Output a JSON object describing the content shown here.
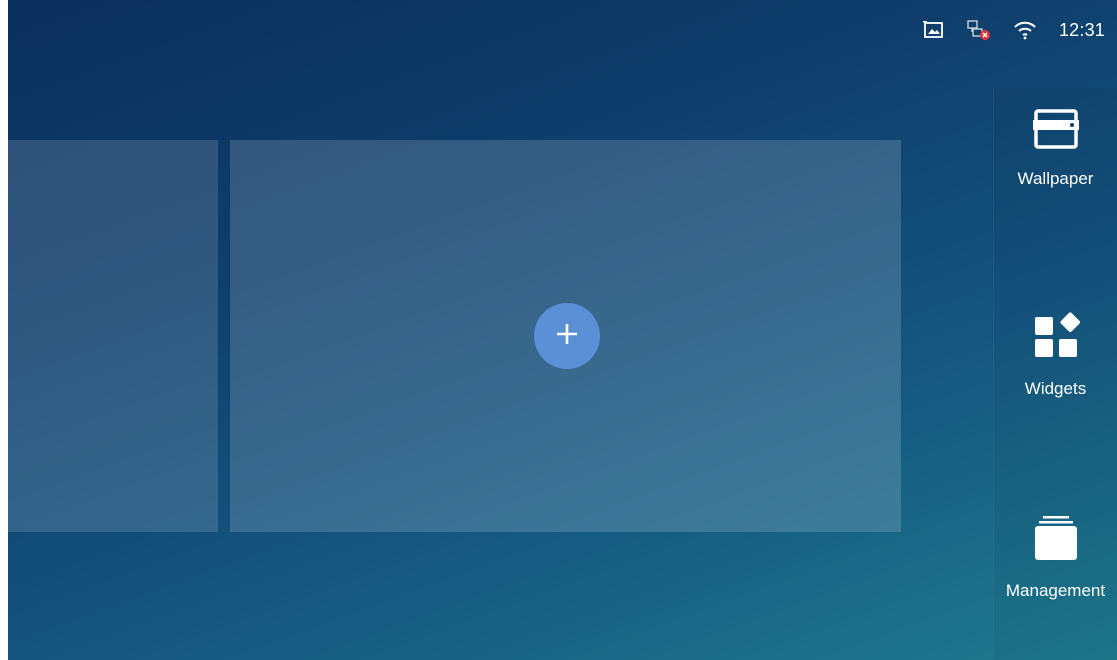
{
  "status_bar": {
    "icons": [
      "screenshot-icon",
      "network-disconnected-icon",
      "wifi-icon"
    ],
    "time": "12:31"
  },
  "home": {
    "add_icon": "plus-icon"
  },
  "panel": {
    "items": [
      {
        "label": "Wallpaper",
        "icon": "wallpaper-icon"
      },
      {
        "label": "Widgets",
        "icon": "widgets-icon"
      },
      {
        "label": "Management",
        "icon": "management-icon"
      }
    ]
  },
  "colors": {
    "background_top": "#0b2f5c",
    "background_bottom": "#1f7a8e",
    "add_button": "#5b8fd6",
    "notification_badge": "#e53935"
  }
}
